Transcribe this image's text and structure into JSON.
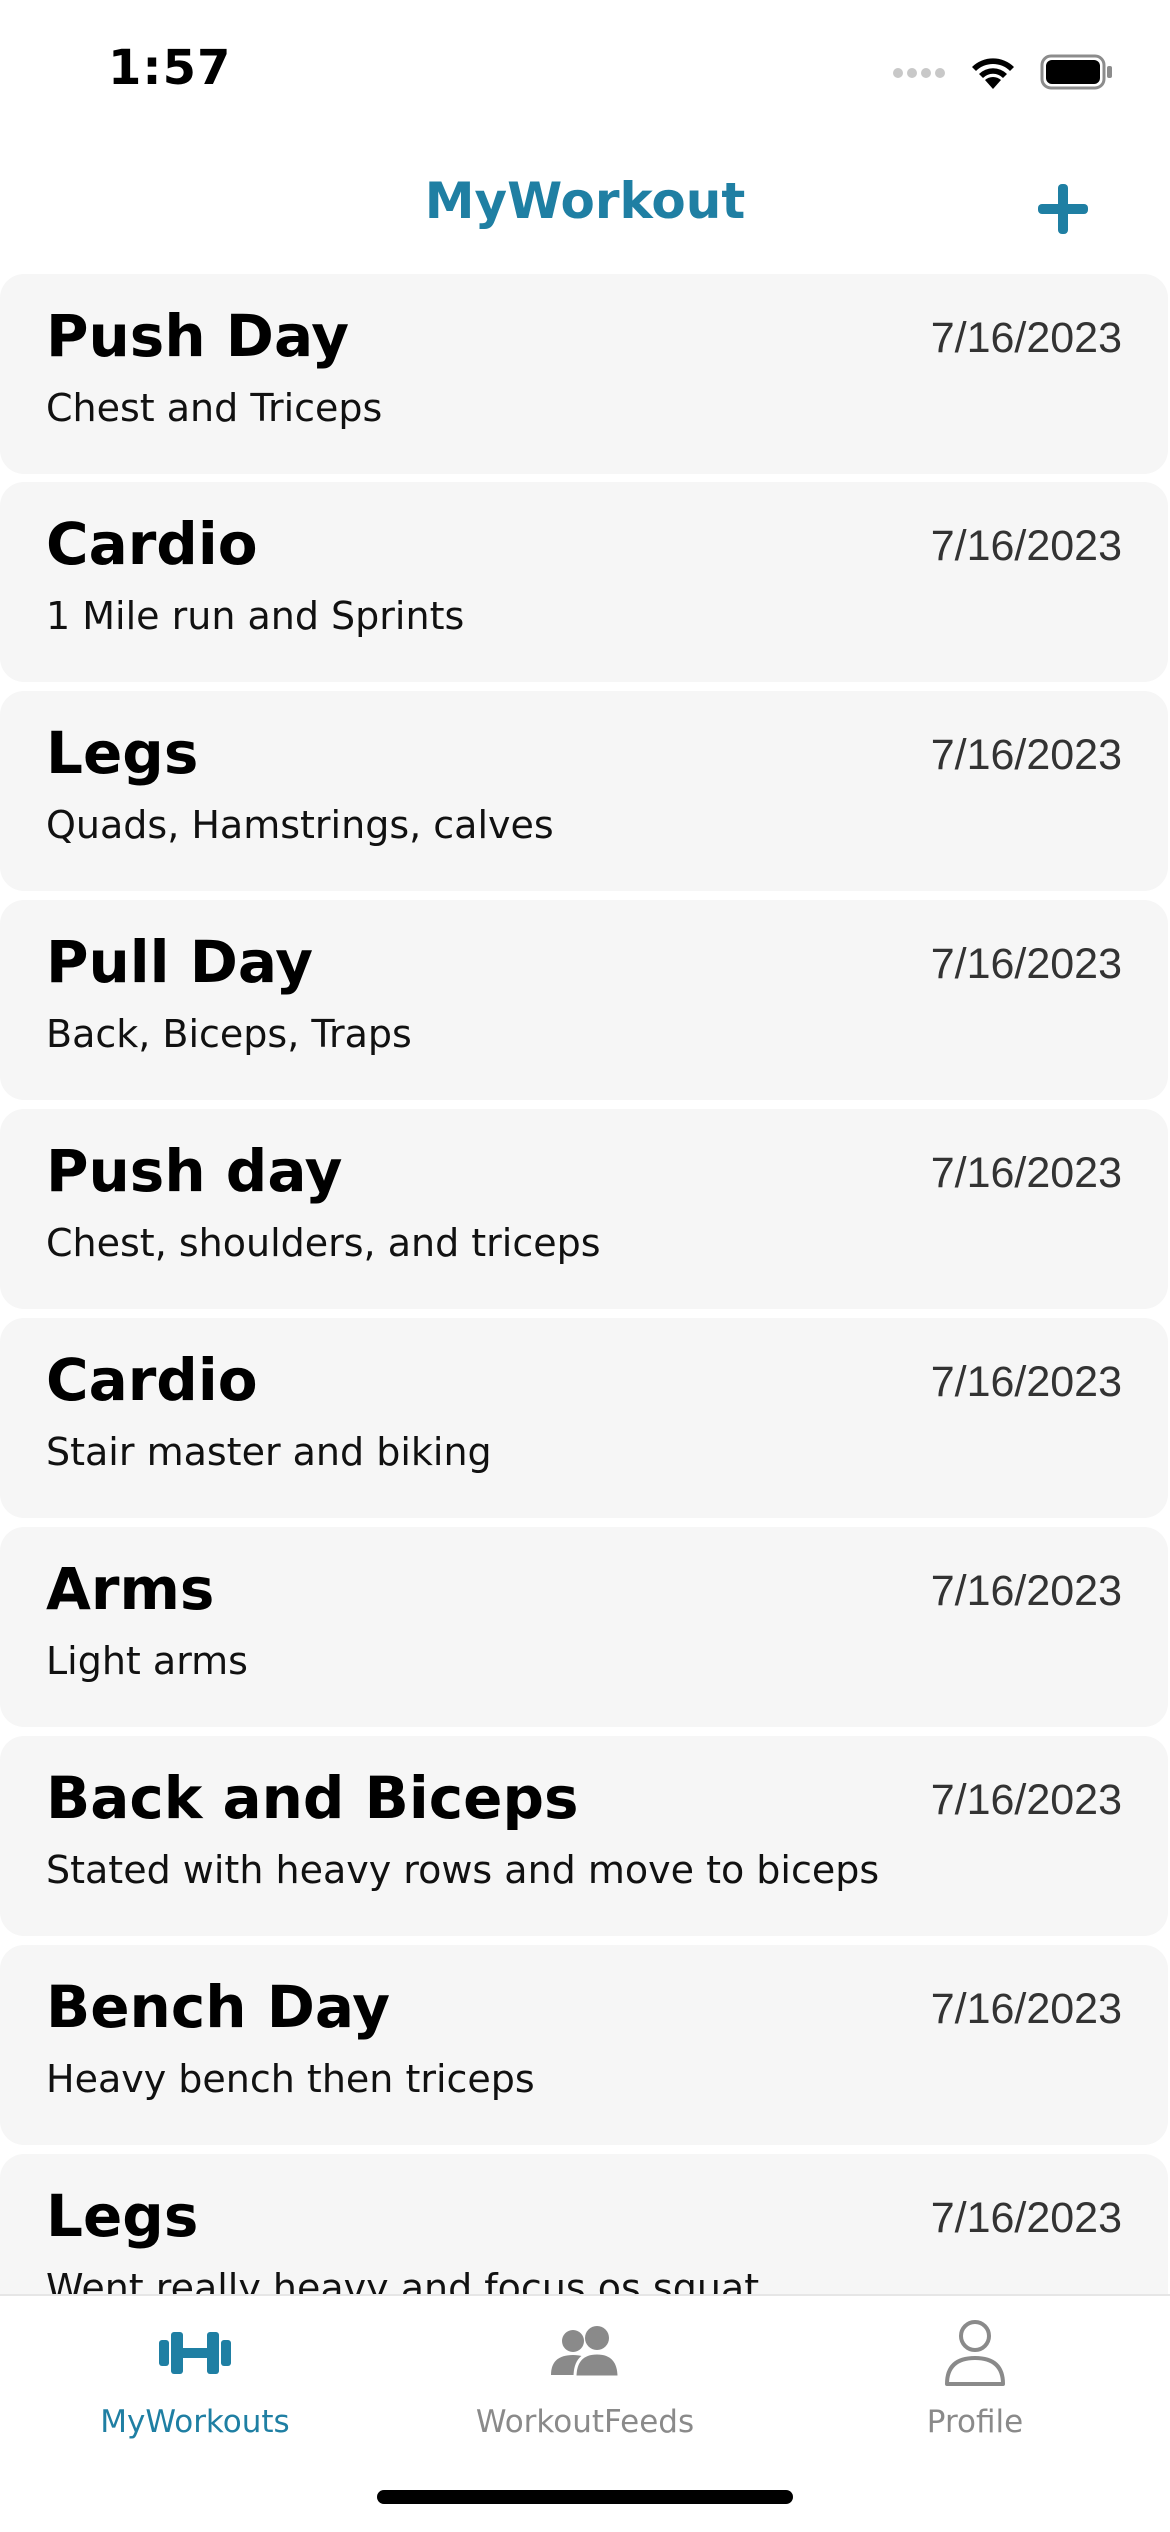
{
  "status_bar": {
    "time": "1:57",
    "icons": [
      "cellular-icon",
      "wifi-icon",
      "battery-icon"
    ]
  },
  "nav": {
    "title": "MyWorkout",
    "add_icon": "plus-icon",
    "accent_color": "#1f7fa3"
  },
  "workouts": [
    {
      "name": "Push Day",
      "description": "Chest and Triceps",
      "date": "7/16/2023"
    },
    {
      "name": "Cardio",
      "description": "1 Mile run and Sprints",
      "date": "7/16/2023"
    },
    {
      "name": "Legs",
      "description": "Quads, Hamstrings, calves",
      "date": "7/16/2023"
    },
    {
      "name": "Pull Day",
      "description": "Back, Biceps, Traps",
      "date": "7/16/2023"
    },
    {
      "name": "Push day",
      "description": "Chest, shoulders, and triceps",
      "date": "7/16/2023"
    },
    {
      "name": "Cardio",
      "description": "Stair master and biking",
      "date": "7/16/2023"
    },
    {
      "name": "Arms",
      "description": "Light arms",
      "date": "7/16/2023"
    },
    {
      "name": "Back and Biceps",
      "description": "Stated with heavy rows and move to biceps",
      "date": "7/16/2023"
    },
    {
      "name": "Bench Day",
      "description": "Heavy bench then triceps",
      "date": "7/16/2023"
    },
    {
      "name": "Legs",
      "description": "Went really heavy and focus os squat",
      "date": "7/16/2023"
    }
  ],
  "tab_bar": {
    "tabs": [
      {
        "label": "MyWorkouts",
        "icon": "dumbbell-icon",
        "active": true
      },
      {
        "label": "WorkoutFeeds",
        "icon": "people-icon",
        "active": false
      },
      {
        "label": "Profile",
        "icon": "person-icon",
        "active": false
      }
    ],
    "active_color": "#1f7fa3",
    "inactive_color": "#8a8a8a"
  }
}
